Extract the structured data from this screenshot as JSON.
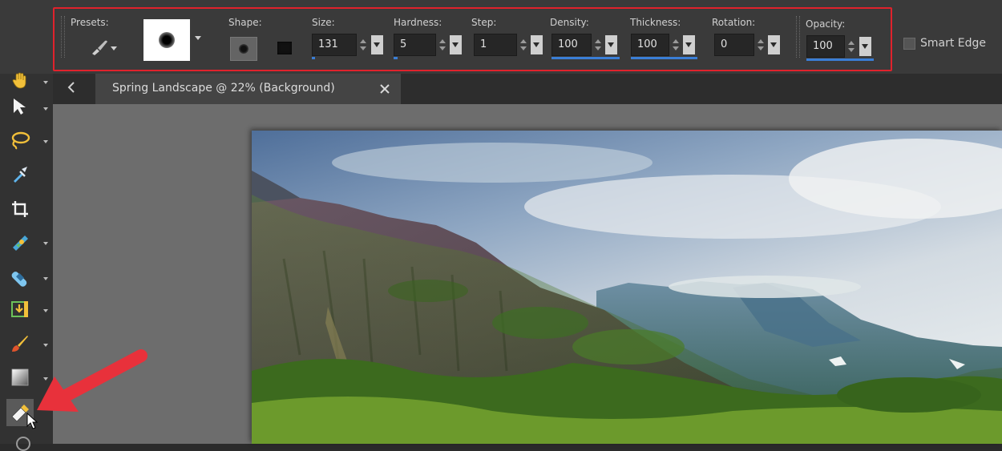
{
  "toolbar": {
    "presets_label": "Presets:",
    "shape_label": "Shape:",
    "size": {
      "label": "Size:",
      "value": "131",
      "fill": 0.02
    },
    "hardness": {
      "label": "Hardness:",
      "value": "5",
      "fill": 0.05
    },
    "step": {
      "label": "Step:",
      "value": "1",
      "fill": 0.0
    },
    "density": {
      "label": "Density:",
      "value": "100",
      "fill": 1.0
    },
    "thickness": {
      "label": "Thickness:",
      "value": "100",
      "fill": 1.0
    },
    "rotation": {
      "label": "Rotation:",
      "value": "0",
      "fill": 0.0
    },
    "opacity": {
      "label": "Opacity:",
      "value": "100",
      "fill": 1.0
    },
    "smart_edge_label": "Smart Edge",
    "highlight_color": "#e0222c",
    "accent_color": "#3a7ed6"
  },
  "tab": {
    "title": "Spring Landscape @  22% (Background)"
  },
  "tools": [
    "pan-tool-icon",
    "pick-tool-icon",
    "lasso-selection-icon",
    "dropper-icon",
    "crop-icon",
    "straighten-icon",
    "repair-brush-icon",
    "text-tool-icon",
    "paint-brush-icon",
    "gradient-fill-icon",
    "eraser-icon"
  ],
  "annotation": {
    "arrow_color": "#e8313b"
  }
}
